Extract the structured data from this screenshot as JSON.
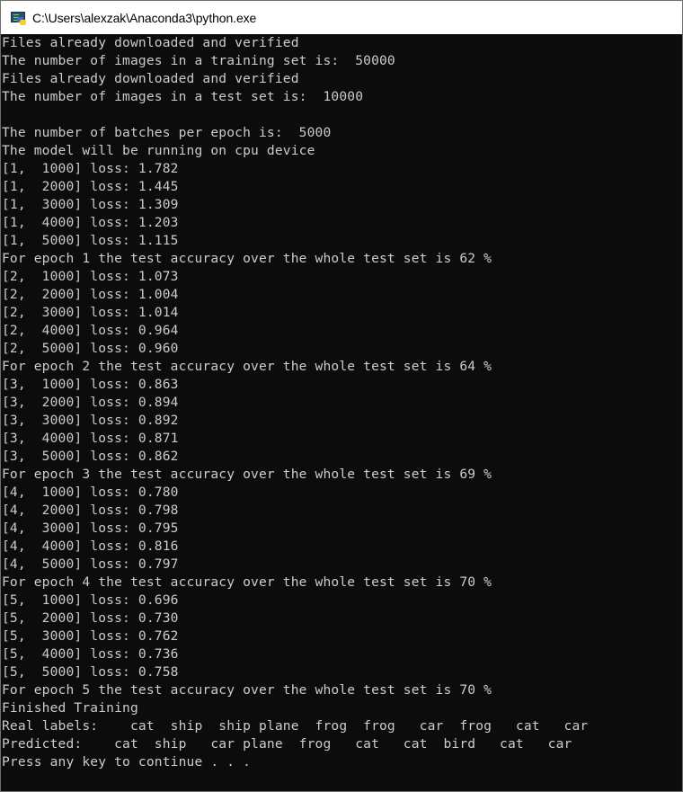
{
  "window": {
    "title": "C:\\Users\\alexzak\\Anaconda3\\python.exe",
    "icon": "python-console-icon",
    "colors": {
      "background": "#0c0c0c",
      "text": "#cccccc",
      "titlebar": "#ffffff"
    }
  },
  "console": {
    "lines": [
      "Files already downloaded and verified",
      "The number of images in a training set is:  50000",
      "Files already downloaded and verified",
      "The number of images in a test set is:  10000",
      "",
      "The number of batches per epoch is:  5000",
      "The model will be running on cpu device",
      "[1,  1000] loss: 1.782",
      "[1,  2000] loss: 1.445",
      "[1,  3000] loss: 1.309",
      "[1,  4000] loss: 1.203",
      "[1,  5000] loss: 1.115",
      "For epoch 1 the test accuracy over the whole test set is 62 %",
      "[2,  1000] loss: 1.073",
      "[2,  2000] loss: 1.004",
      "[2,  3000] loss: 1.014",
      "[2,  4000] loss: 0.964",
      "[2,  5000] loss: 0.960",
      "For epoch 2 the test accuracy over the whole test set is 64 %",
      "[3,  1000] loss: 0.863",
      "[3,  2000] loss: 0.894",
      "[3,  3000] loss: 0.892",
      "[3,  4000] loss: 0.871",
      "[3,  5000] loss: 0.862",
      "For epoch 3 the test accuracy over the whole test set is 69 %",
      "[4,  1000] loss: 0.780",
      "[4,  2000] loss: 0.798",
      "[4,  3000] loss: 0.795",
      "[4,  4000] loss: 0.816",
      "[4,  5000] loss: 0.797",
      "For epoch 4 the test accuracy over the whole test set is 70 %",
      "[5,  1000] loss: 0.696",
      "[5,  2000] loss: 0.730",
      "[5,  3000] loss: 0.762",
      "[5,  4000] loss: 0.736",
      "[5,  5000] loss: 0.758",
      "For epoch 5 the test accuracy over the whole test set is 70 %",
      "Finished Training",
      "Real labels:    cat  ship  ship plane  frog  frog   car  frog   cat   car",
      "Predicted:    cat  ship   car plane  frog   cat   cat  bird   cat   car",
      "Press any key to continue . . ."
    ]
  }
}
